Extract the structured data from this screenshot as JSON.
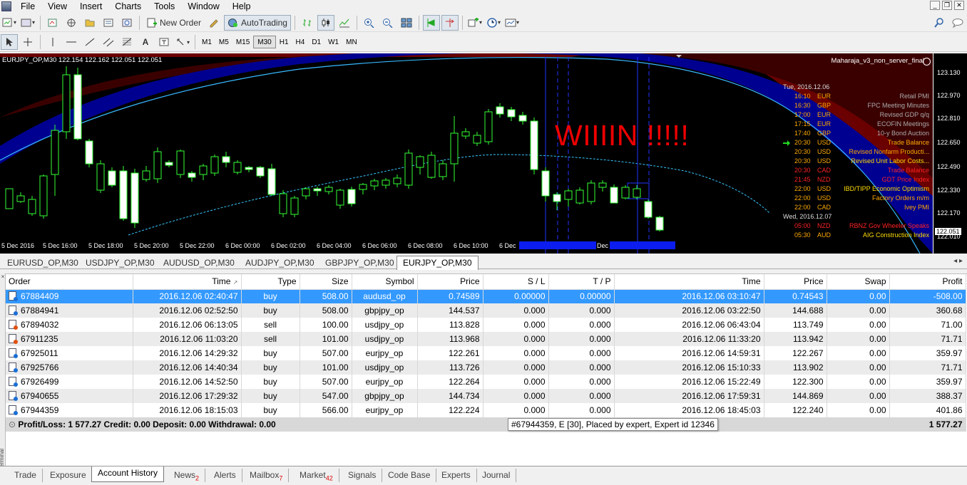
{
  "menu": [
    "File",
    "View",
    "Insert",
    "Charts",
    "Tools",
    "Window",
    "Help"
  ],
  "toolbar": {
    "new_order": "New Order",
    "autotrading": "AutoTrading"
  },
  "timeframes": [
    "M1",
    "M5",
    "M15",
    "M30",
    "H1",
    "H4",
    "D1",
    "W1",
    "MN"
  ],
  "active_timeframe": "M30",
  "chart": {
    "header": "EURJPY_OP,M30  122.154 122.162 122.051 122.051",
    "ea_name": "Maharaja_v3_non_server_final",
    "annotation": "WIIIIN  !!!!!",
    "current_price": "122.051",
    "price_ticks": [
      "123.130",
      "122.970",
      "122.810",
      "122.650",
      "122.490",
      "122.330",
      "122.170",
      "122.010"
    ],
    "time_ticks": [
      "5 Dec 2016",
      "5 Dec 16:00",
      "5 Dec 18:00",
      "5 Dec 20:00",
      "5 Dec 22:00",
      "6 Dec 00:00",
      "6 Dec 02:00",
      "6 Dec 04:00",
      "6 Dec 06:00",
      "6 Dec 08:00",
      "6 Dec 10:00",
      "6 Dec",
      "Dec"
    ],
    "news": [
      {
        "kind": "date",
        "text": "Tue, 2016.12.06"
      },
      {
        "time": "16:10",
        "cur": "EUR",
        "event": "Retail PMI",
        "color": "#aaaaaa",
        "ccolor": "#ffaa00"
      },
      {
        "time": "16:30",
        "cur": "GBP",
        "event": "FPC Meeting Minutes",
        "color": "#aaaaaa",
        "ccolor": "#ffaa00"
      },
      {
        "time": "17:00",
        "cur": "EUR",
        "event": "Revised GDP q/q",
        "color": "#aaaaaa",
        "ccolor": "#ffaa00"
      },
      {
        "time": "17:15",
        "cur": "EUR",
        "event": "ECOFIN Meetings",
        "color": "#aaaaaa",
        "ccolor": "#ffaa00"
      },
      {
        "time": "17:40",
        "cur": "GBP",
        "event": "10-y Bond Auction",
        "color": "#aaaaaa",
        "ccolor": "#ffaa00"
      },
      {
        "time": "20:30",
        "cur": "USD",
        "event": "Trade Balance",
        "color": "#ffaa00",
        "ccolor": "#ffaa00"
      },
      {
        "time": "20:30",
        "cur": "USD",
        "event": "Revised Nonfarm Producti...",
        "color": "#ffaa00",
        "ccolor": "#ffaa00"
      },
      {
        "time": "20:30",
        "cur": "USD",
        "event": "Revised Unit Labor Costs...",
        "color": "#ffdd00",
        "ccolor": "#ffaa00"
      },
      {
        "time": "20:30",
        "cur": "CAD",
        "event": "Trade Balance",
        "color": "#ff2222",
        "ccolor": "#ff2222"
      },
      {
        "time": "21:45",
        "cur": "NZD",
        "event": "GDT Price Index",
        "color": "#ff2222",
        "ccolor": "#ff2222"
      },
      {
        "time": "22:00",
        "cur": "USD",
        "event": "IBD/TIPP Economic Optimism",
        "color": "#ffdd00",
        "ccolor": "#ffaa00"
      },
      {
        "time": "22:00",
        "cur": "USD",
        "event": "Factory Orders m/m",
        "color": "#ffaa00",
        "ccolor": "#ffaa00"
      },
      {
        "time": "22:00",
        "cur": "CAD",
        "event": "Ivey PMI",
        "color": "#ffaa00",
        "ccolor": "#ffaa00"
      },
      {
        "kind": "date",
        "text": "Wed, 2016.12.07"
      },
      {
        "time": "05:00",
        "cur": "NZD",
        "event": "RBNZ Gov Wheeler Speaks",
        "color": "#ff2222",
        "ccolor": "#ff2222"
      },
      {
        "time": "05:30",
        "cur": "AUD",
        "event": "AIG Construction Index",
        "color": "#ffdd00",
        "ccolor": "#ffaa00"
      }
    ]
  },
  "chart_tabs": [
    "EURUSD_OP,M30",
    "USDJPY_OP,M30",
    "AUDUSD_OP,M30",
    "AUDJPY_OP,M30",
    "GBPJPY_OP,M30",
    "EURJPY_OP,M30"
  ],
  "active_chart_tab": "EURJPY_OP,M30",
  "history": {
    "columns": [
      "Order",
      "Time",
      "Type",
      "Size",
      "Symbol",
      "Price",
      "S / L",
      "T / P",
      "Time",
      "Price",
      "Swap",
      "Profit"
    ],
    "rows": [
      [
        "67884409",
        "2016.12.06 02:40:47",
        "buy",
        "508.00",
        "audusd_op",
        "0.74589",
        "0.00000",
        "0.00000",
        "2016.12.06 03:10:47",
        "0.74543",
        "0.00",
        "-508.00"
      ],
      [
        "67884941",
        "2016.12.06 02:52:50",
        "buy",
        "508.00",
        "gbpjpy_op",
        "144.537",
        "0.000",
        "0.000",
        "2016.12.06 03:22:50",
        "144.688",
        "0.00",
        "360.68"
      ],
      [
        "67894032",
        "2016.12.06 06:13:05",
        "sell",
        "100.00",
        "usdjpy_op",
        "113.828",
        "0.000",
        "0.000",
        "2016.12.06 06:43:04",
        "113.749",
        "0.00",
        "71.00"
      ],
      [
        "67911235",
        "2016.12.06 11:03:20",
        "sell",
        "101.00",
        "usdjpy_op",
        "113.968",
        "0.000",
        "0.000",
        "2016.12.06 11:33:20",
        "113.942",
        "0.00",
        "71.71"
      ],
      [
        "67925011",
        "2016.12.06 14:29:32",
        "buy",
        "507.00",
        "eurjpy_op",
        "122.261",
        "0.000",
        "0.000",
        "2016.12.06 14:59:31",
        "122.267",
        "0.00",
        "359.97"
      ],
      [
        "67925766",
        "2016.12.06 14:40:34",
        "buy",
        "101.00",
        "usdjpy_op",
        "113.726",
        "0.000",
        "0.000",
        "2016.12.06 15:10:33",
        "113.902",
        "0.00",
        "71.71"
      ],
      [
        "67926499",
        "2016.12.06 14:52:50",
        "buy",
        "507.00",
        "eurjpy_op",
        "122.264",
        "0.000",
        "0.000",
        "2016.12.06 15:22:49",
        "122.300",
        "0.00",
        "359.97"
      ],
      [
        "67940655",
        "2016.12.06 17:29:32",
        "buy",
        "547.00",
        "gbpjpy_op",
        "144.734",
        "0.000",
        "0.000",
        "2016.12.06 17:59:31",
        "144.869",
        "0.00",
        "388.37"
      ],
      [
        "67944359",
        "2016.12.06 18:15:03",
        "buy",
        "566.00",
        "eurjpy_op",
        "122.224",
        "0.000",
        "0.000",
        "2016.12.06 18:45:03",
        "122.240",
        "0.00",
        "401.86"
      ]
    ],
    "summary": "Profit/Loss: 1 577.27  Credit: 0.00  Deposit: 0.00  Withdrawal: 0.00",
    "summary_total": "1 577.27",
    "tooltip": "#67944359, E [30], Placed by expert, Expert id 12346"
  },
  "terminal_label": "Terminal",
  "bottom_tabs": [
    {
      "label": "Trade",
      "badge": ""
    },
    {
      "label": "Exposure",
      "badge": ""
    },
    {
      "label": "Account History",
      "badge": ""
    },
    {
      "label": "News",
      "badge": "2"
    },
    {
      "label": "Alerts",
      "badge": ""
    },
    {
      "label": "Mailbox",
      "badge": "7"
    },
    {
      "label": "Market",
      "badge": "42"
    },
    {
      "label": "Signals",
      "badge": ""
    },
    {
      "label": "Code Base",
      "badge": ""
    },
    {
      "label": "Experts",
      "badge": ""
    },
    {
      "label": "Journal",
      "badge": ""
    }
  ],
  "active_bottom_tab": "Account History"
}
